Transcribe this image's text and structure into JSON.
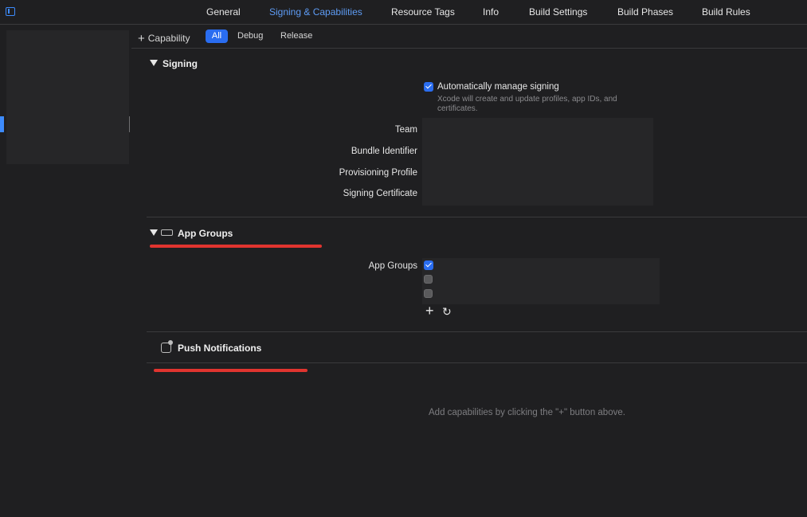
{
  "tabs": [
    {
      "label": "General",
      "active": false
    },
    {
      "label": "Signing & Capabilities",
      "active": true
    },
    {
      "label": "Resource Tags",
      "active": false
    },
    {
      "label": "Info",
      "active": false
    },
    {
      "label": "Build Settings",
      "active": false
    },
    {
      "label": "Build Phases",
      "active": false
    },
    {
      "label": "Build Rules",
      "active": false
    }
  ],
  "toolbar": {
    "add_capability_label": "Capability",
    "filters": [
      "All",
      "Debug",
      "Release"
    ],
    "selected_filter": "All"
  },
  "signing": {
    "title": "Signing",
    "auto_manage_label": "Automatically manage signing",
    "auto_manage_checked": true,
    "auto_manage_note_line1": "Xcode will create and update profiles, app IDs, and",
    "auto_manage_note_line2": "certificates.",
    "fields": [
      "Team",
      "Bundle Identifier",
      "Provisioning Profile",
      "Signing Certificate"
    ]
  },
  "app_groups": {
    "title": "App Groups",
    "label": "App Groups",
    "checkbox_states": [
      true,
      false,
      false
    ]
  },
  "push_notifications": {
    "title": "Push Notifications"
  },
  "empty_hint": "Add capabilities by clicking the \"+\" button above.",
  "colors": {
    "accent": "#2a6df0",
    "active_tab": "#5e9cf5",
    "annotation_underline": "#e0342f",
    "background": "#1f1f21"
  }
}
